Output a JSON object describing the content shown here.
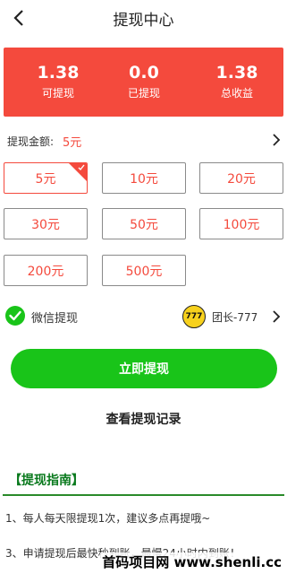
{
  "header": {
    "title": "提现中心",
    "back_icon": "back-arrow-icon"
  },
  "stats": [
    {
      "value": "1.38",
      "label": "可提现"
    },
    {
      "value": "0.0",
      "label": "已提现"
    },
    {
      "value": "1.38",
      "label": "总收益"
    }
  ],
  "amount": {
    "label": "提现金额:",
    "value": "5元"
  },
  "options": [
    "5元",
    "10元",
    "20元",
    "30元",
    "50元",
    "100元",
    "200元",
    "500元"
  ],
  "selected_option": "5元",
  "payment": {
    "method_label": "微信提现",
    "avatar_text": "777",
    "team_name": "团长-777"
  },
  "actions": {
    "withdraw_label": "立即提现",
    "records_label": "查看提现记录"
  },
  "guide": {
    "title": "【提现指南】",
    "items": [
      "1、每人每天限提现1次，建议多点再提哦~",
      "3、申请提现后最快秒到账，最慢24小时内到账！"
    ]
  },
  "watermark": "首码项目网 www.shenli.cc",
  "colors": {
    "accent": "#f44a3d",
    "wechat_green": "#19c419",
    "guide_green": "#0a7a1e"
  }
}
